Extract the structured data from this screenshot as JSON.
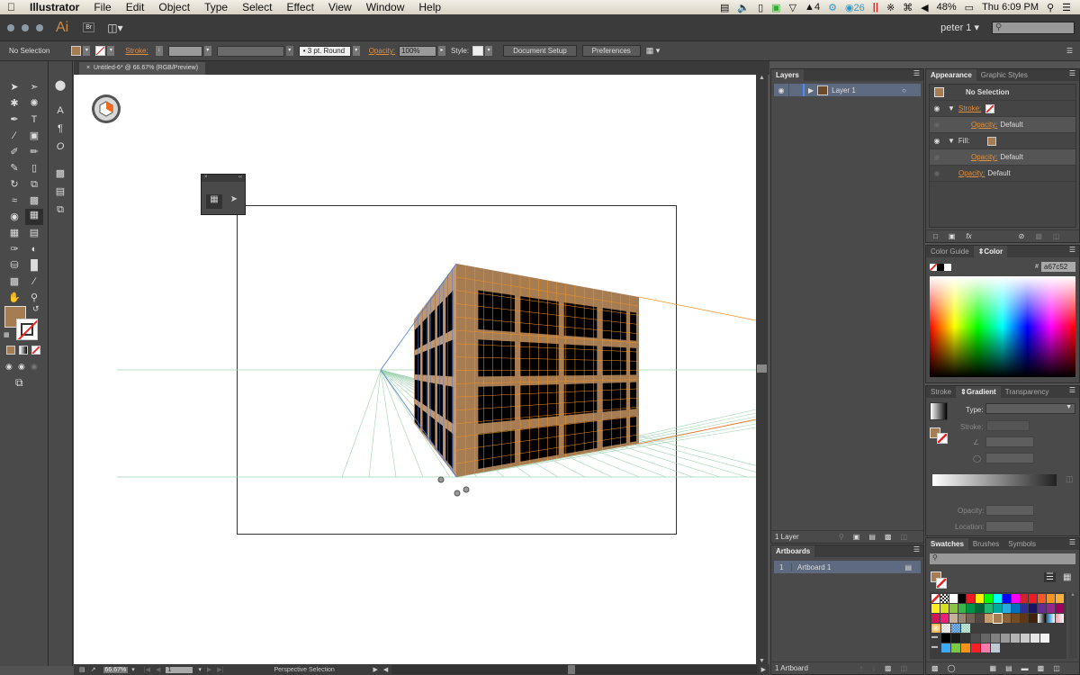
{
  "menubar": {
    "app_name": "Illustrator",
    "menus": [
      "File",
      "Edit",
      "Object",
      "Type",
      "Select",
      "Effect",
      "View",
      "Window",
      "Help"
    ],
    "status": {
      "adobe_count": "4",
      "cc_count": "26",
      "battery": "48%",
      "clock": "Thu 6:09 PM"
    }
  },
  "appbar": {
    "logo": "Ai",
    "bridge": "Br",
    "workspace_user": "peter 1",
    "search_placeholder": ""
  },
  "control_bar": {
    "selection_label": "No Selection",
    "fill_color": "#a67c52",
    "stroke_label": "Stroke:",
    "brush_value": "3 pt. Round",
    "opacity_label": "Opacity:",
    "opacity_value": "100%",
    "style_label": "Style:",
    "document_setup": "Document Setup",
    "preferences": "Preferences"
  },
  "document_tab": {
    "title": "Untitled-6* @ 66.67% (RGB/Preview)",
    "close": "×"
  },
  "status_bar": {
    "zoom": "66.67%",
    "artboard_number": "1",
    "tool_status": "Perspective Selection"
  },
  "layers_panel": {
    "title": "Layers",
    "layers": [
      {
        "name": "Layer 1"
      }
    ],
    "footer": "1 Layer"
  },
  "artboards_panel": {
    "title": "Artboards",
    "artboards": [
      {
        "index": "1",
        "name": "Artboard 1"
      }
    ],
    "footer": "1 Artboard"
  },
  "appearance_panel": {
    "tabs": [
      "Appearance",
      "Graphic Styles"
    ],
    "header": "No Selection",
    "stroke_label": "Stroke:",
    "fill_label": "Fill:",
    "opacity_label": "Opacity:",
    "opacity_value": "Default"
  },
  "color_panel": {
    "tabs": [
      "Color Guide",
      "Color"
    ],
    "hex_value": "a67c52"
  },
  "gradient_panel": {
    "tabs": [
      "Stroke",
      "Gradient",
      "Transparency"
    ],
    "type_label": "Type:",
    "stroke_label": "Stroke:",
    "opacity_label": "Opacity:",
    "location_label": "Location:"
  },
  "swatches_panel": {
    "tabs": [
      "Swatches",
      "Brushes",
      "Symbols"
    ],
    "rows": [
      [
        "none",
        "reg",
        "#ffffff",
        "#000000",
        "#ed1c24",
        "#fff200",
        "#00ff00",
        "#00ffff",
        "#0000ff",
        "#ff00ff",
        "#d2232a",
        "#ed1c24",
        "#f15a24",
        "#f7931e",
        "#fbb03b"
      ],
      [
        "#fcee21",
        "#d9e021",
        "#8cc63f",
        "#39b54a",
        "#009245",
        "#006837",
        "#22b573",
        "#00a99d",
        "#29abe2",
        "#0071bc",
        "#2e3192",
        "#1b1464",
        "#662d91",
        "#93278f",
        "#9e005d"
      ],
      [
        "#d4145a",
        "#ed1e79",
        "#c7b299",
        "#998675",
        "#736357",
        "#534741",
        "#c69c6d",
        "#a67c52",
        "#8c6239",
        "#754c24",
        "#603813",
        "#42210b",
        "grad1",
        "grad2",
        "grad3"
      ],
      [
        "pat1",
        "pat2",
        "pat3",
        "pat4"
      ],
      [
        "folder",
        "#000000",
        "#1a1a1a",
        "#333333",
        "#4d4d4d",
        "#666666",
        "#808080",
        "#999999",
        "#b3b3b3",
        "#cccccc",
        "#e6e6e6",
        "#f2f2f2"
      ],
      [
        "folder",
        "#3fa9f5",
        "#7ac943",
        "#ff931e",
        "#ff1d25",
        "#ff7bac",
        "#bdccd4"
      ]
    ]
  },
  "colors": {
    "accent_orange": "#e08f3b",
    "building_fill": "#a67c52",
    "grid_orange": "#f7931e",
    "grid_blue": "#4a7fd4",
    "grid_green": "#7cbf7c"
  }
}
